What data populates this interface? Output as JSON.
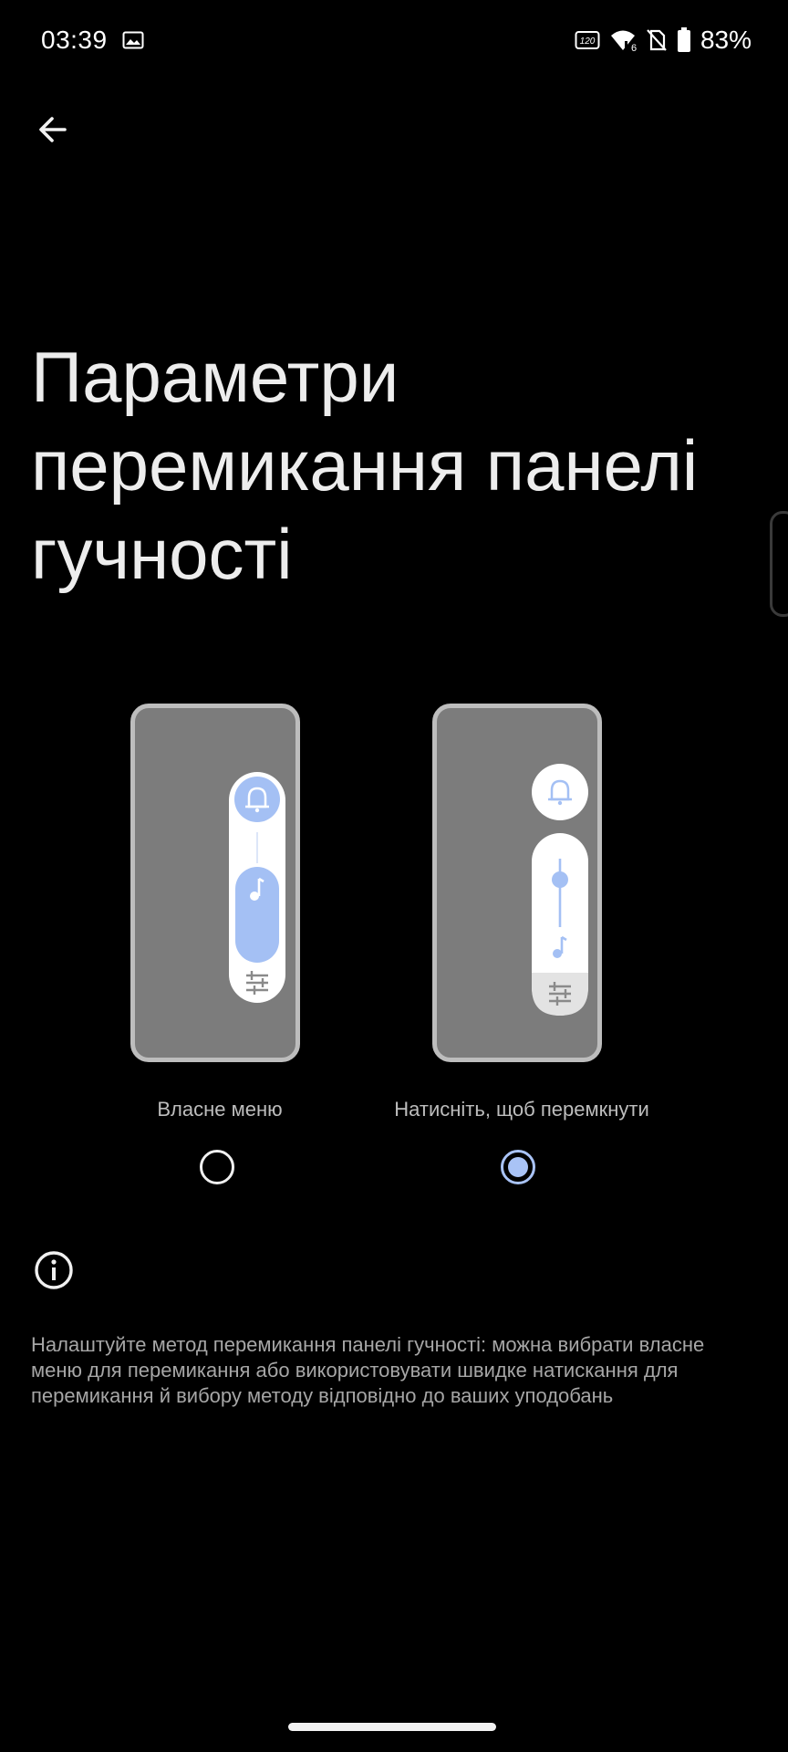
{
  "status_bar": {
    "time": "03:39",
    "refresh_rate_badge": "120Hz",
    "battery": "83%",
    "icons": [
      "image-icon",
      "refresh-rate-icon",
      "wifi-icon",
      "no-sim-icon",
      "battery-icon"
    ]
  },
  "header": {
    "back_icon": "arrow-left-icon"
  },
  "page": {
    "title": "Параметри перемикання панелі гучності",
    "options": [
      {
        "label": "Власне меню",
        "selected": false
      },
      {
        "label": "Натисніть, щоб перемкнути",
        "selected": true
      }
    ],
    "info_icon": "info-icon",
    "description": "Налаштуйте метод перемикання панелі гучності: можна вибрати власне меню для перемикання або використовувати швидке натискання для перемикання й вибору методу відповідно до ваших уподобань"
  },
  "colors": {
    "background": "#000000",
    "accent": "#a9c3f6",
    "illustration_blue": "#a4c0f4",
    "phone_screen": "#7c7c7c",
    "phone_frame": "#bdbdbd"
  }
}
